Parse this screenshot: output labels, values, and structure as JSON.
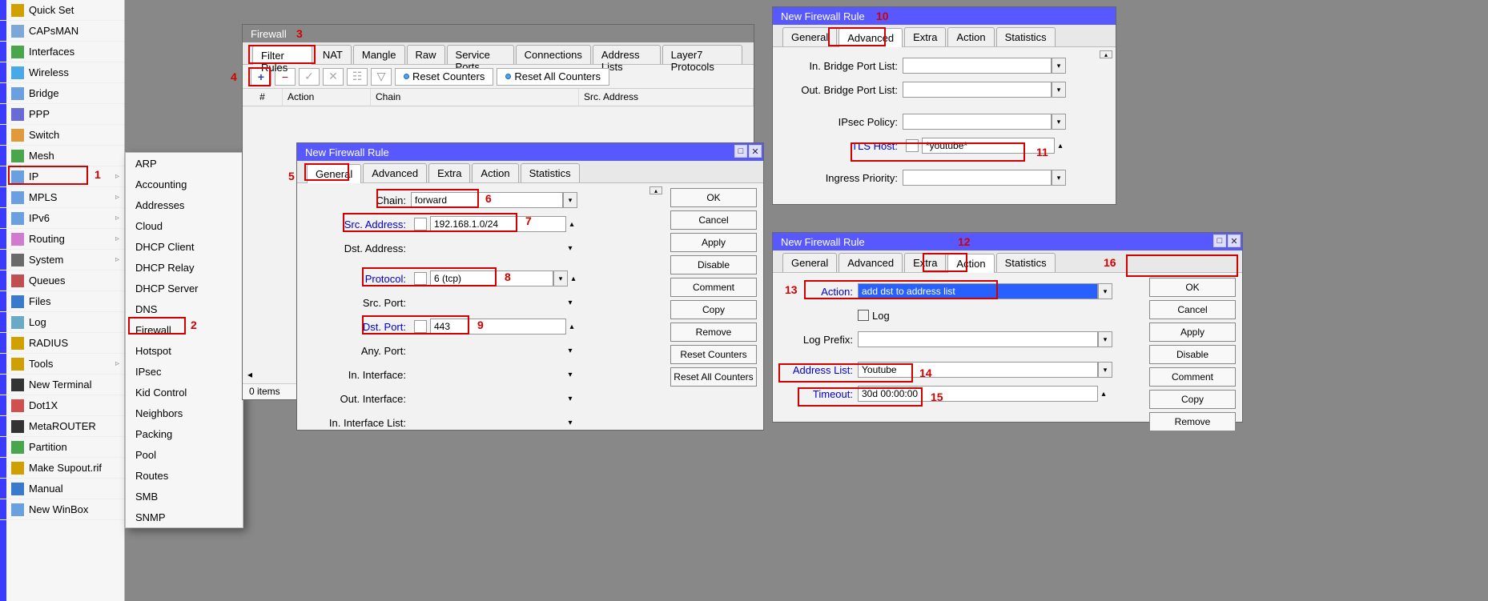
{
  "sidebar": {
    "items": [
      "Quick Set",
      "CAPsMAN",
      "Interfaces",
      "Wireless",
      "Bridge",
      "PPP",
      "Switch",
      "Mesh",
      "IP",
      "MPLS",
      "IPv6",
      "Routing",
      "System",
      "Queues",
      "Files",
      "Log",
      "RADIUS",
      "Tools",
      "New Terminal",
      "Dot1X",
      "MetaROUTER",
      "Partition",
      "Make Supout.rif",
      "Manual",
      "New WinBox"
    ],
    "expandable": [
      8,
      9,
      10,
      11,
      12,
      17
    ]
  },
  "submenu": {
    "items": [
      "ARP",
      "Accounting",
      "Addresses",
      "Cloud",
      "DHCP Client",
      "DHCP Relay",
      "DHCP Server",
      "DNS",
      "Firewall",
      "Hotspot",
      "IPsec",
      "Kid Control",
      "Neighbors",
      "Packing",
      "Pool",
      "Routes",
      "SMB",
      "SNMP"
    ]
  },
  "sidebar_icon_colors": [
    "#d0a000",
    "#7BA7D9",
    "#4aa64a",
    "#48a9e6",
    "#6aa0e0",
    "#6a6ad6",
    "#e09a3a",
    "#4aa64a",
    "#6aa0e0",
    "#6aa0e0",
    "#6aa0e0",
    "#d07ad0",
    "#6a6a6a",
    "#c05050",
    "#3a7acc",
    "#6aaac6",
    "#d0a000",
    "#d0a000",
    "#333",
    "#d05050",
    "#333",
    "#4aa64a",
    "#d0a000",
    "#3a7acc",
    "#6aa0e0"
  ],
  "firewall": {
    "title": "Firewall",
    "tabs": [
      "Filter Rules",
      "NAT",
      "Mangle",
      "Raw",
      "Service Ports",
      "Connections",
      "Address Lists",
      "Layer7 Protocols"
    ],
    "active_tab": 0,
    "toolbar": {
      "reset": "Reset Counters",
      "reset_all": "Reset All Counters"
    },
    "columns": [
      "#",
      "Action",
      "Chain",
      "Src. Address"
    ],
    "status": "0 items"
  },
  "rule_general": {
    "title": "New Firewall Rule",
    "tabs": [
      "General",
      "Advanced",
      "Extra",
      "Action",
      "Statistics"
    ],
    "active_tab": 0,
    "buttons": [
      "OK",
      "Cancel",
      "Apply",
      "Disable",
      "Comment",
      "Copy",
      "Remove",
      "Reset Counters",
      "Reset All Counters"
    ],
    "fields": {
      "chain": {
        "label": "Chain:",
        "value": "forward"
      },
      "src": {
        "label": "Src. Address:",
        "value": "192.168.1.0/24"
      },
      "dst": {
        "label": "Dst. Address:",
        "value": ""
      },
      "proto": {
        "label": "Protocol:",
        "value": "6 (tcp)"
      },
      "srcport": {
        "label": "Src. Port:",
        "value": ""
      },
      "dstport": {
        "label": "Dst. Port:",
        "value": "443"
      },
      "anyport": {
        "label": "Any. Port:",
        "value": ""
      },
      "inif": {
        "label": "In. Interface:",
        "value": ""
      },
      "outif": {
        "label": "Out. Interface:",
        "value": ""
      },
      "iniflist": {
        "label": "In. Interface List:",
        "value": ""
      }
    }
  },
  "rule_advanced": {
    "title": "New Firewall Rule",
    "tabs": [
      "General",
      "Advanced",
      "Extra",
      "Action",
      "Statistics"
    ],
    "active_tab": 1,
    "fields": {
      "inbridge": {
        "label": "In. Bridge Port List:",
        "value": ""
      },
      "outbridge": {
        "label": "Out. Bridge Port List:",
        "value": ""
      },
      "ipsec": {
        "label": "IPsec Policy:",
        "value": ""
      },
      "tls": {
        "label": "TLS Host:",
        "value": "*youtube*"
      },
      "ingress": {
        "label": "Ingress Priority:",
        "value": ""
      }
    }
  },
  "rule_action": {
    "title": "New Firewall Rule",
    "tabs": [
      "General",
      "Advanced",
      "Extra",
      "Action",
      "Statistics"
    ],
    "active_tab": 3,
    "buttons": [
      "OK",
      "Cancel",
      "Apply",
      "Disable",
      "Comment",
      "Copy",
      "Remove"
    ],
    "fields": {
      "action": {
        "label": "Action:",
        "value": "add dst to address list"
      },
      "log": {
        "label": "Log"
      },
      "logprefix": {
        "label": "Log Prefix:",
        "value": ""
      },
      "addrlist": {
        "label": "Address List:",
        "value": "Youtube"
      },
      "timeout": {
        "label": "Timeout:",
        "value": "30d 00:00:00"
      }
    }
  },
  "annotations": {
    "1": "1",
    "2": "2",
    "3": "3",
    "4": "4",
    "5": "5",
    "6": "6",
    "7": "7",
    "8": "8",
    "9": "9",
    "10": "10",
    "11": "11",
    "12": "12",
    "13": "13",
    "14": "14",
    "15": "15",
    "16": "16"
  }
}
